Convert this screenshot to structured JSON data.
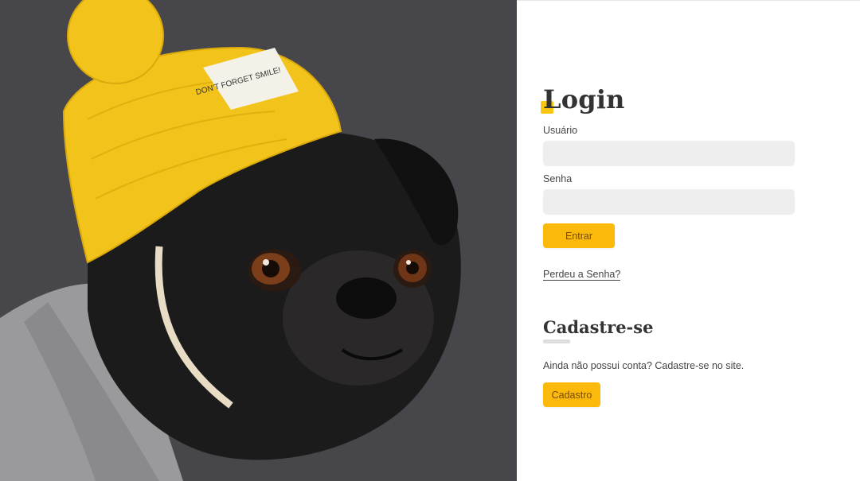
{
  "hero": {
    "image_alt": "Pug wearing a yellow knit hat",
    "hat_label_text": "DON'T FORGET SMILE!",
    "colors": {
      "hat": "#fbc60f",
      "background": "#3e3e42"
    }
  },
  "login": {
    "title": "Login",
    "username_label": "Usuário",
    "username_value": "",
    "password_label": "Senha",
    "password_value": "",
    "submit_label": "Entrar",
    "lost_password_link": "Perdeu a Senha?"
  },
  "register": {
    "title": "Cadastre-se",
    "text": "Ainda não possui conta? Cadastre-se no site.",
    "button_label": "Cadastro"
  },
  "colors": {
    "accent": "#fbb90c",
    "accent_text": "#7a4b00",
    "input_bg": "#eeeeee",
    "text": "#444444",
    "heading": "#333333"
  }
}
